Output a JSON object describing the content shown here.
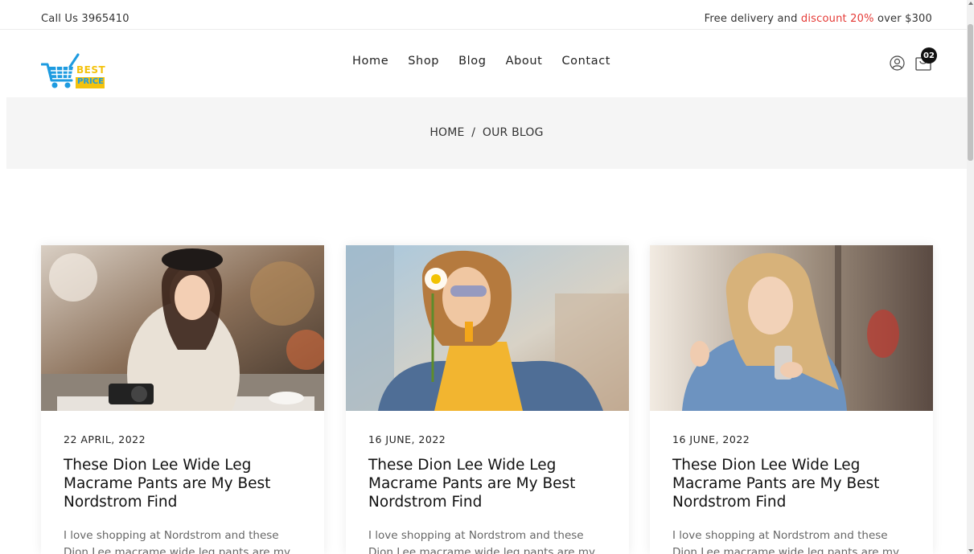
{
  "topbar": {
    "phone": "Call Us 3965410",
    "promo_before": "Free delivery and ",
    "promo_accent": "discount 20%",
    "promo_after": " over $300",
    "accent_color": "#e53935"
  },
  "brand": {
    "logo_line1": "BEST",
    "logo_line2": "PRICE",
    "logo_blue": "#1e9be0",
    "logo_yellow": "#f4c20d"
  },
  "nav": {
    "items": [
      "Home",
      "Shop",
      "Blog",
      "About",
      "Contact"
    ]
  },
  "header_icons": {
    "user": "user-icon",
    "cart": "shopping-bag-icon",
    "cart_count": "02"
  },
  "breadcrumb": {
    "home": "HOME",
    "separator": "/",
    "current": "OUR BLOG"
  },
  "posts": [
    {
      "date": "22 APRIL, 2022",
      "title": "These Dion Lee Wide Leg Macrame Pants are My Best Nordstrom Find",
      "excerpt": "I love shopping at Nordstrom and these Dion Lee macrame wide leg pants are my"
    },
    {
      "date": "16 JUNE, 2022",
      "title": "These Dion Lee Wide Leg Macrame Pants are My Best Nordstrom Find",
      "excerpt": "I love shopping at Nordstrom and these Dion Lee macrame wide leg pants are my"
    },
    {
      "date": "16 JUNE, 2022",
      "title": "These Dion Lee Wide Leg Macrame Pants are My Best Nordstrom Find",
      "excerpt": "I love shopping at Nordstrom and these Dion Lee macrame wide leg pants are my"
    }
  ]
}
